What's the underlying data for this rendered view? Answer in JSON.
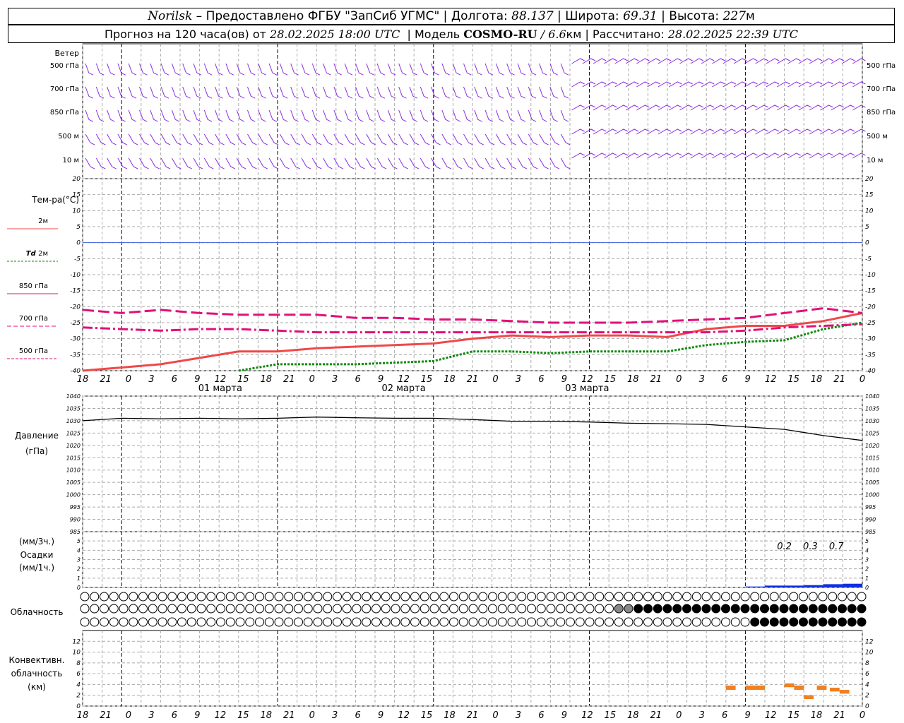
{
  "header": {
    "city": "Norilsk",
    "dash": "–",
    "provider": "Предоставлено ФГБУ \"ЗапСиб УГМС\"",
    "sep": "|",
    "lon_label": "Долгота:",
    "lon_value": "88.137",
    "lat_label": "Широта:",
    "lat_value": "69.31",
    "alt_label": "Высота:",
    "alt_value": "227",
    "alt_unit": "м",
    "forecast_label": "Прогноз на 120 часа(ов) от",
    "forecast_start": "28.02.2025 18:00 UTC",
    "model_label": "Модель",
    "model_name": "COSMO-RU",
    "model_slash": "/",
    "model_res": "6.6",
    "model_res_unit": "км",
    "calc_label": "Рассчитано:",
    "calc_time": "28.02.2025 22:39 UTC"
  },
  "colors": {
    "wind": "#8a2be2",
    "t2m": "#f04848",
    "td2m": "#0a8a0a",
    "t850": "#e0107a",
    "t700": "#e0107a",
    "t500": "#e0107a",
    "zero_line": "#4060e0",
    "pressure": "#000000",
    "precip": "#1030e0",
    "convective": "#f08020",
    "grid": "#aaaaaa"
  },
  "time_axis": {
    "ticks": [
      "18",
      "21",
      "0",
      "3",
      "6",
      "9",
      "12",
      "15",
      "18",
      "21",
      "0",
      "3",
      "6",
      "9",
      "12",
      "15",
      "18",
      "21",
      "0",
      "3",
      "6",
      "9",
      "12",
      "15",
      "18",
      "21",
      "0",
      "3",
      "6",
      "9",
      "12",
      "15",
      "18",
      "21",
      "0"
    ],
    "day_labels": [
      {
        "text": "01 марта",
        "at_index": 6
      },
      {
        "text": "02 марта",
        "at_index": 14
      },
      {
        "text": "03 марта",
        "at_index": 22
      }
    ]
  },
  "wind_panel": {
    "title": "Ветер",
    "levels": [
      "500 гПа",
      "700 гПа",
      "850 гПа",
      "500 м",
      "10 м"
    ],
    "right_levels": [
      "500 гПа",
      "700 гПа",
      "850 гПа",
      "500 м",
      "10 м"
    ]
  },
  "temp_panel": {
    "title": "Тем-ра(°C)",
    "legend": [
      {
        "label": "2м",
        "key": "t2m"
      },
      {
        "label_italic": "Td",
        "label": "2м",
        "key": "td2m"
      },
      {
        "label": "850 гПа",
        "key": "t850"
      },
      {
        "label": "700 гПа",
        "key": "t700"
      },
      {
        "label": "500 гПа",
        "key": "t500"
      }
    ],
    "ticks": [
      "20",
      "15",
      "10",
      "5",
      "0",
      "-5",
      "-10",
      "-15",
      "-20",
      "-25",
      "-30",
      "-35",
      "-40"
    ]
  },
  "pressure_panel": {
    "title": "Давление",
    "unit": "(гПа)",
    "ticks": [
      "1040",
      "1035",
      "1030",
      "1025",
      "1020",
      "1015",
      "1010",
      "1005",
      "1000",
      "995",
      "990",
      "985"
    ]
  },
  "precip_panel": {
    "unit3h": "(мм/3ч.)",
    "title": "Осадки",
    "unit1h": "(мм/1ч.)",
    "ticks": [
      "5",
      "4",
      "3",
      "2",
      "1",
      "0"
    ],
    "labels": [
      "0.2",
      "0.3",
      "0.7"
    ]
  },
  "cloud_panel": {
    "title": "Облачность"
  },
  "conv_panel": {
    "title1": "Конвективн.",
    "title2": "облачность",
    "unit": "(км)",
    "ticks": [
      "12",
      "10",
      "8",
      "6",
      "4",
      "2",
      "0"
    ]
  },
  "chart_data": [
    {
      "type": "line",
      "title": "Тем-ра(°C)",
      "x_hours": [
        0,
        6,
        12,
        18,
        24,
        30,
        36,
        42,
        48,
        54,
        60,
        66,
        72,
        78,
        84,
        90,
        96,
        102,
        108,
        114,
        120
      ],
      "series": [
        {
          "name": "2м",
          "values": [
            -40,
            -39,
            -38,
            -36,
            -34,
            -34,
            -33,
            -32.5,
            -32,
            -31.5,
            -30,
            -29,
            -29.5,
            -29,
            -29,
            -29.5,
            -27,
            -26,
            -26,
            -24.5,
            -22
          ]
        },
        {
          "name": "Td 2м",
          "values": [
            null,
            null,
            null,
            null,
            -40,
            -38,
            -38,
            -38,
            -37.5,
            -37,
            -34,
            -34,
            -34.5,
            -34,
            -34,
            -34,
            -32,
            -31,
            -30.5,
            -27,
            -25
          ]
        },
        {
          "name": "850 гПа",
          "values": [
            -21,
            -22,
            -21,
            -22,
            -22.5,
            -22.5,
            -22.5,
            -23.5,
            -23.5,
            -24,
            -24,
            -24.5,
            -25,
            -25,
            -25,
            -24.5,
            -24,
            -23.5,
            -22,
            -20.5,
            -22
          ]
        },
        {
          "name": "700 гПа",
          "values": [
            -26.5,
            -27,
            -27.5,
            -27,
            -27,
            -27.5,
            -28,
            -28,
            -28,
            -28,
            -28,
            -28,
            -28,
            -28,
            -28,
            -28,
            -28,
            -27.5,
            -26.5,
            -26,
            -25.5
          ]
        }
      ],
      "ylim": [
        -40,
        20
      ]
    },
    {
      "type": "line",
      "title": "Давление",
      "x_hours": [
        0,
        6,
        12,
        18,
        24,
        30,
        36,
        42,
        48,
        54,
        60,
        66,
        72,
        78,
        84,
        90,
        96,
        102,
        108,
        114,
        120
      ],
      "series": [
        {
          "name": "Давление",
          "values": [
            1030,
            1031,
            1030.8,
            1031,
            1030.8,
            1031,
            1031.5,
            1031.2,
            1031,
            1031,
            1030.5,
            1029.8,
            1029.8,
            1029.5,
            1029,
            1028.8,
            1028.5,
            1027.5,
            1026.5,
            1024,
            1022
          ]
        }
      ],
      "ylim": [
        985,
        1040
      ]
    },
    {
      "type": "bar",
      "title": "Осадки",
      "x_hours": [
        105,
        108,
        111,
        114,
        117,
        120
      ],
      "values": [
        0.1,
        0.2,
        0.2,
        0.25,
        0.35,
        0.4
      ],
      "ylim": [
        0,
        5
      ]
    },
    {
      "type": "bar",
      "title": "Конвективн. облачность",
      "segments": [
        {
          "x_hours": [
            99,
            100.5
          ],
          "base": 3,
          "top": 3.8
        },
        {
          "x_hours": [
            102,
            105
          ],
          "base": 3,
          "top": 3.8
        },
        {
          "x_hours": [
            108,
            109.5
          ],
          "base": 3.5,
          "top": 4.2
        },
        {
          "x_hours": [
            109.5,
            111
          ],
          "base": 3,
          "top": 3.8
        },
        {
          "x_hours": [
            111,
            112.5
          ],
          "base": 1.3,
          "top": 2.0
        },
        {
          "x_hours": [
            113,
            114.5
          ],
          "base": 3,
          "top": 3.8
        },
        {
          "x_hours": [
            115,
            116.5
          ],
          "base": 2.7,
          "top": 3.4
        },
        {
          "x_hours": [
            116.5,
            118
          ],
          "base": 2.3,
          "top": 3.0
        }
      ],
      "ylim": [
        0,
        13
      ]
    }
  ]
}
